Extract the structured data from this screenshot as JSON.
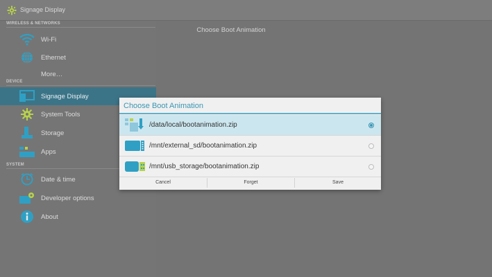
{
  "window": {
    "title": "Signage Display"
  },
  "sidebar": {
    "sections": [
      {
        "header": "WIRELESS & NETWORKS"
      },
      {
        "header": "DEVICE"
      },
      {
        "header": "SYSTEM"
      }
    ],
    "items": [
      {
        "label": "Wi-Fi",
        "icon": "wifi-icon"
      },
      {
        "label": "Ethernet",
        "icon": "globe-icon"
      },
      {
        "label": "More…",
        "icon": ""
      },
      {
        "label": "Signage Display",
        "icon": "display-icon",
        "selected": true
      },
      {
        "label": "System Tools",
        "icon": "gear-icon"
      },
      {
        "label": "Storage",
        "icon": "storage-icon"
      },
      {
        "label": "Apps",
        "icon": "apps-icon"
      },
      {
        "label": "Date & time",
        "icon": "clock-icon"
      },
      {
        "label": "Developer options",
        "icon": "developer-icon"
      },
      {
        "label": "About",
        "icon": "info-icon"
      }
    ]
  },
  "main": {
    "title": "Choose Boot Animation"
  },
  "dialog": {
    "title": "Choose Boot Animation",
    "options": [
      {
        "path": "/data/local/bootanimation.zip",
        "icon": "internal-storage-icon",
        "selected": true
      },
      {
        "path": "/mnt/external_sd/bootanimation.zip",
        "icon": "sd-card-icon",
        "selected": false
      },
      {
        "path": "/mnt/usb_storage/bootanimation.zip",
        "icon": "usb-icon",
        "selected": false
      }
    ],
    "buttons": {
      "cancel": "Cancel",
      "forget": "Forget",
      "save": "Save"
    }
  },
  "colors": {
    "accent": "#3b95b3",
    "selected_row": "#3c7487",
    "dialog_selected": "#cce6ef"
  }
}
